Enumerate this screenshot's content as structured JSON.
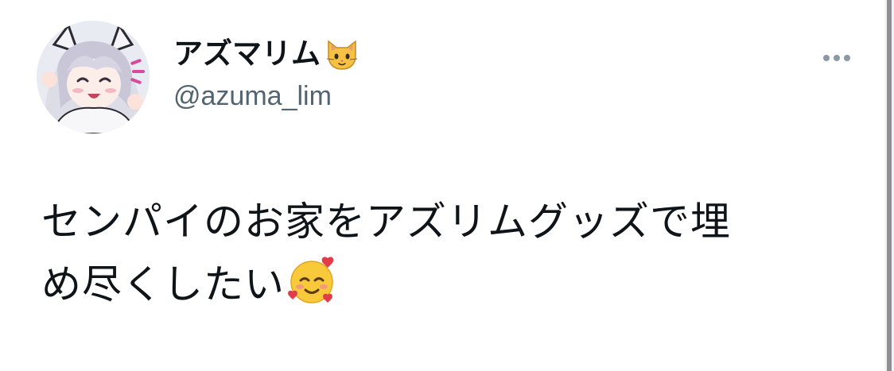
{
  "author": {
    "display_name": "アズマリム",
    "name_emoji_icon": "cat-face-icon",
    "handle": "@azuma_lim",
    "avatar_icon": "avatar-illustration"
  },
  "tweet": {
    "text_line1": "センパイのお家をアズリムグッズで埋",
    "text_line2": "め尽くしたい",
    "trailing_emoji_icon": "smiling-face-with-hearts-icon"
  },
  "actions": {
    "more_icon": "more-options-icon"
  },
  "colors": {
    "text_primary": "#0f1419",
    "text_secondary": "#536471",
    "icon_gray": "#8b98a5",
    "background": "#ffffff"
  }
}
